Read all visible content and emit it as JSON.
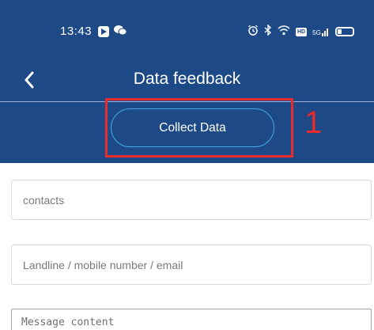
{
  "status_bar": {
    "time": "13:43",
    "left_icons": [
      "app-notification-icon",
      "wechat-icon"
    ],
    "right_icons": [
      "alarm-icon",
      "bluetooth-icon",
      "wifi-icon",
      "hd-icon",
      "5g-signal-icon",
      "battery-icon"
    ],
    "hd_label": "HD",
    "network_label": "5G"
  },
  "header": {
    "title": "Data feedback",
    "back_icon": "chevron-left-icon"
  },
  "action": {
    "collect_label": "Collect Data"
  },
  "annotation": {
    "number": "1",
    "color": "#e52b2b"
  },
  "form": {
    "contacts_placeholder": "contacts",
    "contact_info_placeholder": "Landline / mobile number / email",
    "message_placeholder": "Message content"
  },
  "colors": {
    "primary": "#1d4a86",
    "button_border": "#46a8e8"
  }
}
